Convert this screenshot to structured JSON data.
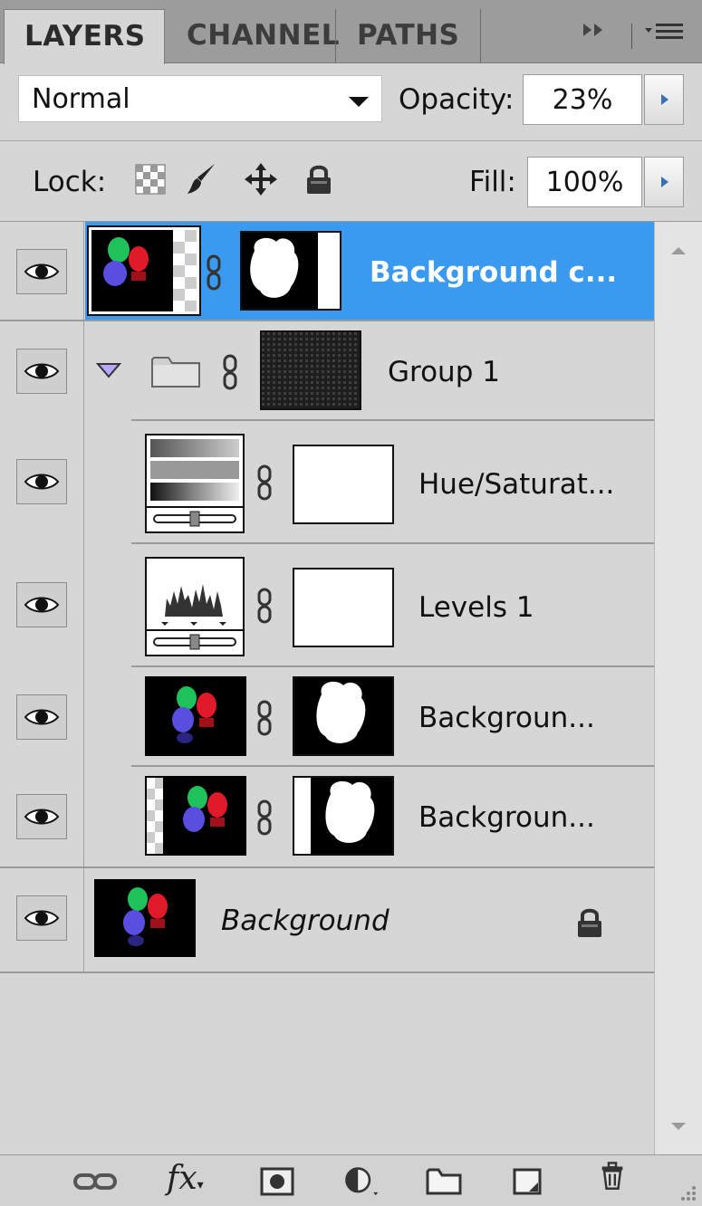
{
  "tabs": [
    {
      "label": "LAYERS",
      "active": true
    },
    {
      "label": "CHANNEL",
      "active": false
    },
    {
      "label": "PATHS",
      "active": false
    }
  ],
  "tab_icons": [
    "expand-arrows-icon",
    "panel-menu-icon"
  ],
  "blend_mode": "Normal",
  "opacity": {
    "label": "Opacity:",
    "value": "23%"
  },
  "lock": {
    "label": "Lock:",
    "icons": [
      "lock-transparent-pixels-icon",
      "lock-image-pixels-icon",
      "lock-position-icon",
      "lock-all-icon"
    ]
  },
  "fill": {
    "label": "Fill:",
    "value": "100%"
  },
  "layers": [
    {
      "name": "Background c...",
      "selected": true,
      "kind": "pixel-mask"
    },
    {
      "name": "Group 1",
      "kind": "group",
      "expanded": true
    },
    {
      "name": "Hue/Saturat...",
      "kind": "adjustment-hue"
    },
    {
      "name": "Levels 1",
      "kind": "adjustment-levels"
    },
    {
      "name": "Backgroun...",
      "kind": "pixel-mask"
    },
    {
      "name": "Backgroun...",
      "kind": "pixel-mask"
    },
    {
      "name": "Background",
      "kind": "background",
      "locked": true,
      "italic": true
    }
  ],
  "bottom_icons": [
    "link-layers-icon",
    "fx-icon",
    "add-mask-icon",
    "adjustment-layer-icon",
    "new-group-icon",
    "new-layer-icon",
    "delete-layer-icon"
  ],
  "fx_label": "fx",
  "colors": {
    "selection": "#3a9af0",
    "panel": "#d6d6d6",
    "tabbar": "#9c9c9c"
  }
}
